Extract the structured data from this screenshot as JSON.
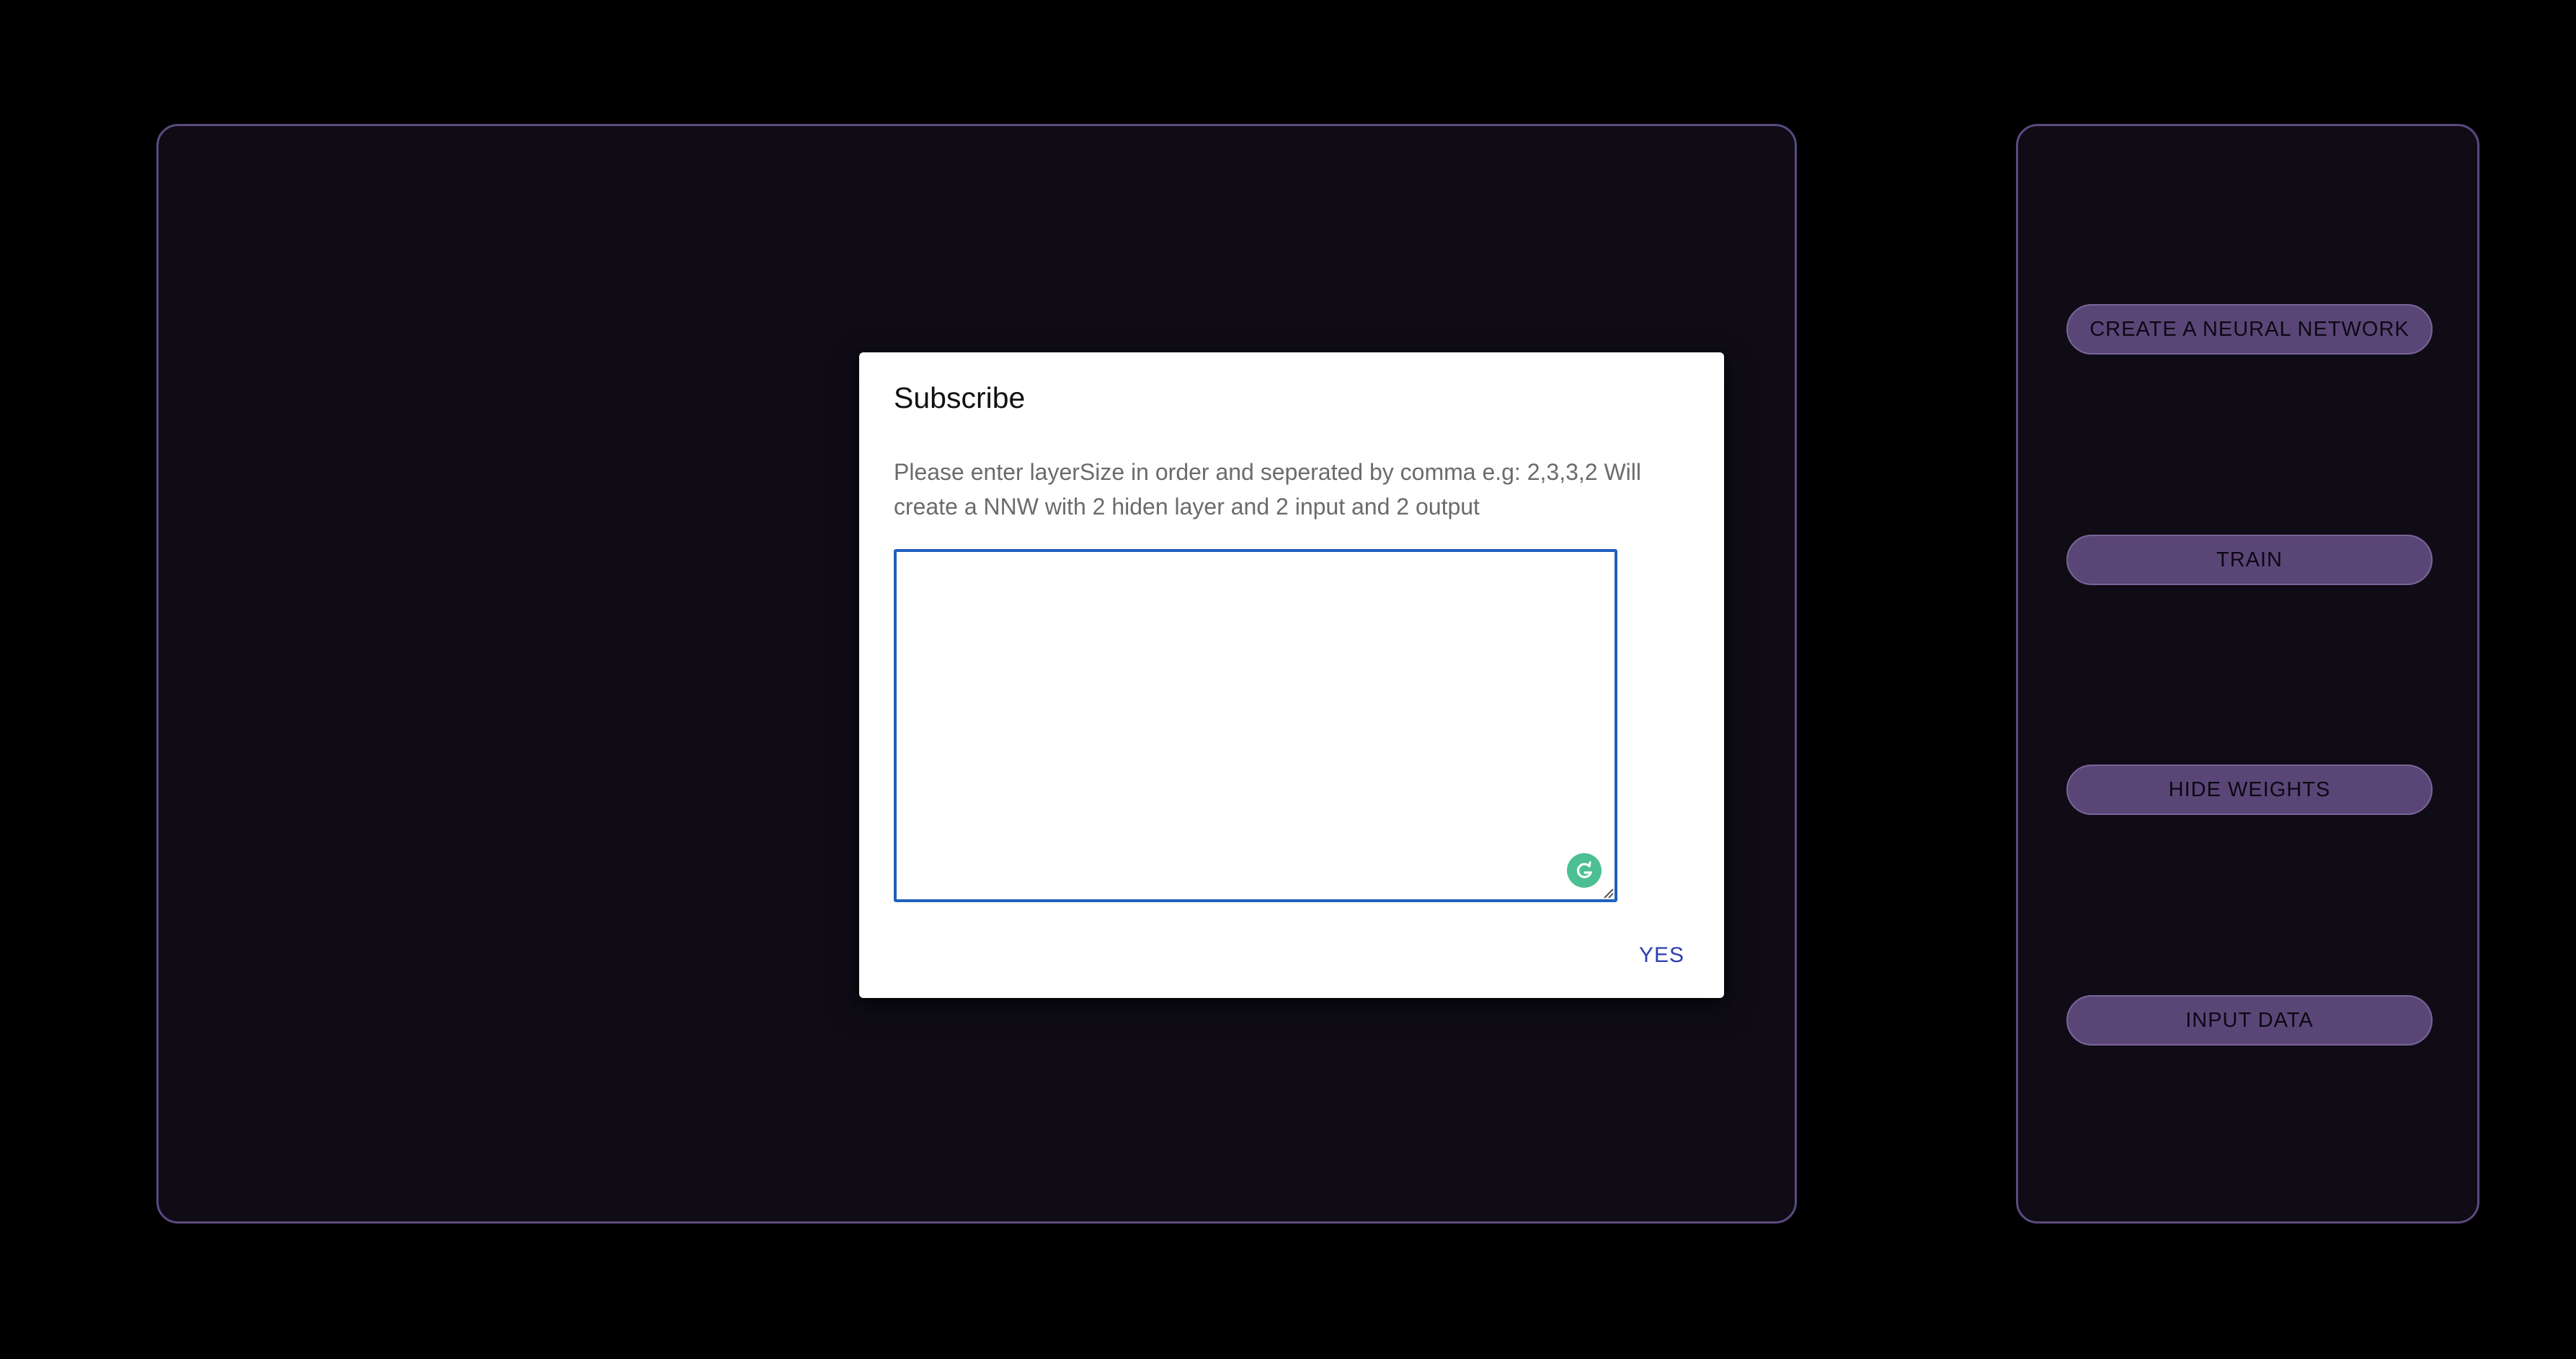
{
  "control_panel": {
    "buttons": [
      {
        "label": "CREATE A NEURAL NETWORK"
      },
      {
        "label": "TRAIN"
      },
      {
        "label": "HIDE WEIGHTS"
      },
      {
        "label": "INPUT DATA"
      }
    ]
  },
  "dialog": {
    "title": "Subscribe",
    "description": "Please enter layerSize in order and seperated by comma e.g: 2,3,3,2 Will create a NNW with 2 hiden layer and 2 input and 2 output",
    "input_value": "",
    "confirm_label": "YES"
  },
  "colors": {
    "background": "#000000",
    "panel": "#0f0c16",
    "panel_border": "#5b4a80",
    "button": "#5a4676",
    "focus_blue": "#1f5fbf",
    "grammarly_green": "#4cbf94"
  }
}
